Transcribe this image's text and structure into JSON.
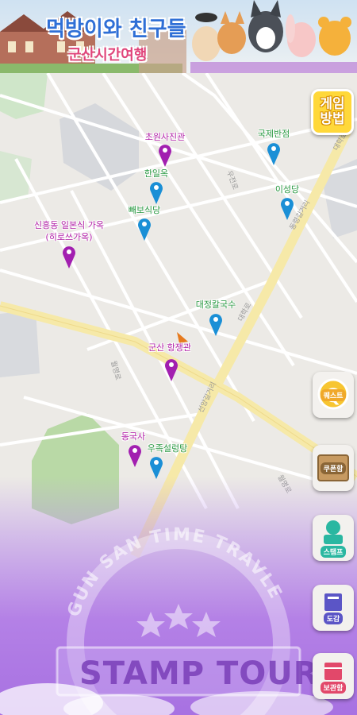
{
  "header": {
    "title": "먹방이와 친구들",
    "subtitle": "군산시간여행"
  },
  "map": {
    "roads": [
      "우전로",
      "대학로",
      "동령길거리",
      "월명로",
      "대학로",
      "선양길거리",
      "월명로"
    ]
  },
  "pins": [
    {
      "label": "초원사진관",
      "color": "purple"
    },
    {
      "label": "국제반점",
      "color": "blue"
    },
    {
      "label": "한일옥",
      "color": "blue"
    },
    {
      "label": "이성당",
      "color": "blue"
    },
    {
      "label": "빼보식당",
      "color": "blue"
    },
    {
      "label": "신흥동 일본식 가옥",
      "label2": "(히로쓰가옥)",
      "color": "purple"
    },
    {
      "label": "대정칼국수",
      "color": "blue"
    },
    {
      "label": "군산 항쟁관",
      "color": "purple"
    },
    {
      "label": "동국사",
      "color": "purple"
    },
    {
      "label": "우족설렁탕",
      "color": "blue"
    }
  ],
  "side_buttons": {
    "rules": {
      "line1": "게임",
      "line2": "방법"
    },
    "quest": "퀘스트",
    "coupon": "쿠폰함",
    "stamp": "스탬프",
    "guide": "도감",
    "storage": "보관함"
  },
  "stamp_banner": {
    "arc_text": "GUN SAN TIME TRAVLE",
    "main_text": "STAMP TOUR"
  },
  "colors": {
    "pin_blue": "#1a8fd6",
    "pin_purple": "#a21fb0",
    "label_green": "#2a9a43",
    "label_purple": "#b21fa8",
    "bottom_purple": "#a66be0"
  }
}
